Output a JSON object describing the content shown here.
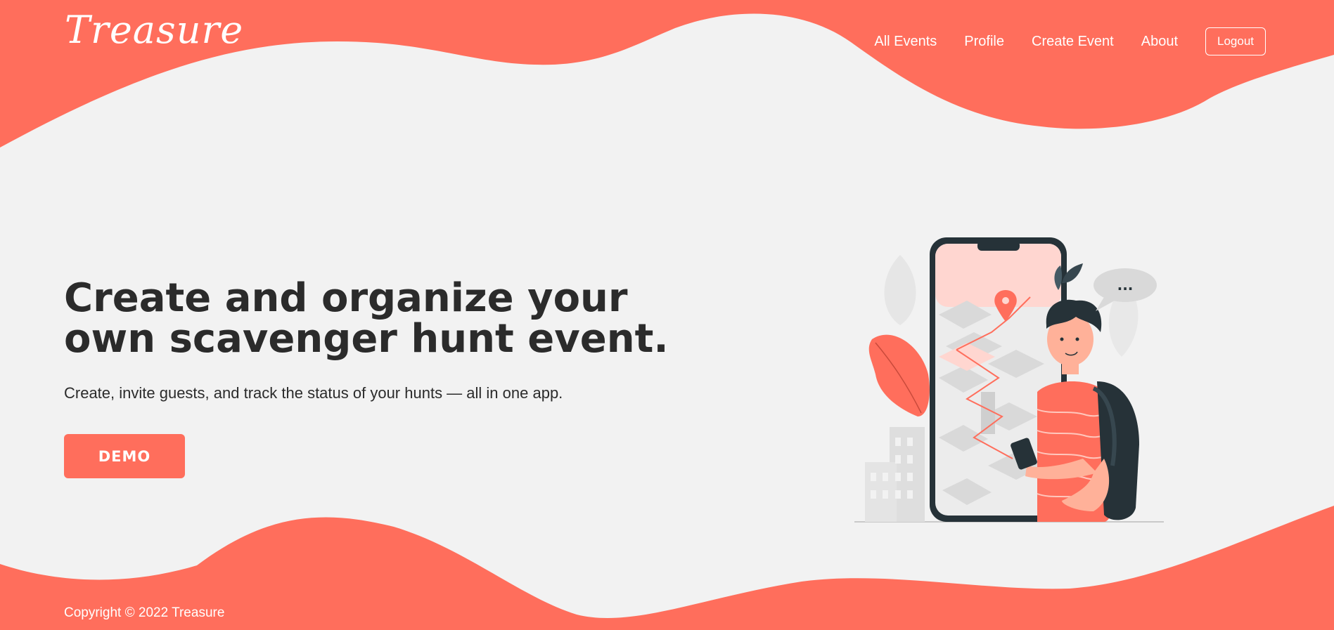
{
  "header": {
    "logo": "Treasure",
    "nav": [
      {
        "label": "All Events"
      },
      {
        "label": "Profile"
      },
      {
        "label": "Create Event"
      },
      {
        "label": "About"
      }
    ],
    "logout_label": "Logout"
  },
  "hero": {
    "title": "Create and organize your own scavenger hunt event.",
    "subtitle": "Create, invite guests, and track the status of your hunts — all in one app.",
    "demo_label": "DEMO"
  },
  "illustration": {
    "bubble_text": "..."
  },
  "footer": {
    "copyright": "Copyright © 2022 Treasure"
  },
  "colors": {
    "accent": "#ff6e5c",
    "background": "#f2f2f2",
    "text": "#2b2b2b"
  },
  "icons": [
    "map-pin-icon",
    "speech-bubble-icon"
  ]
}
